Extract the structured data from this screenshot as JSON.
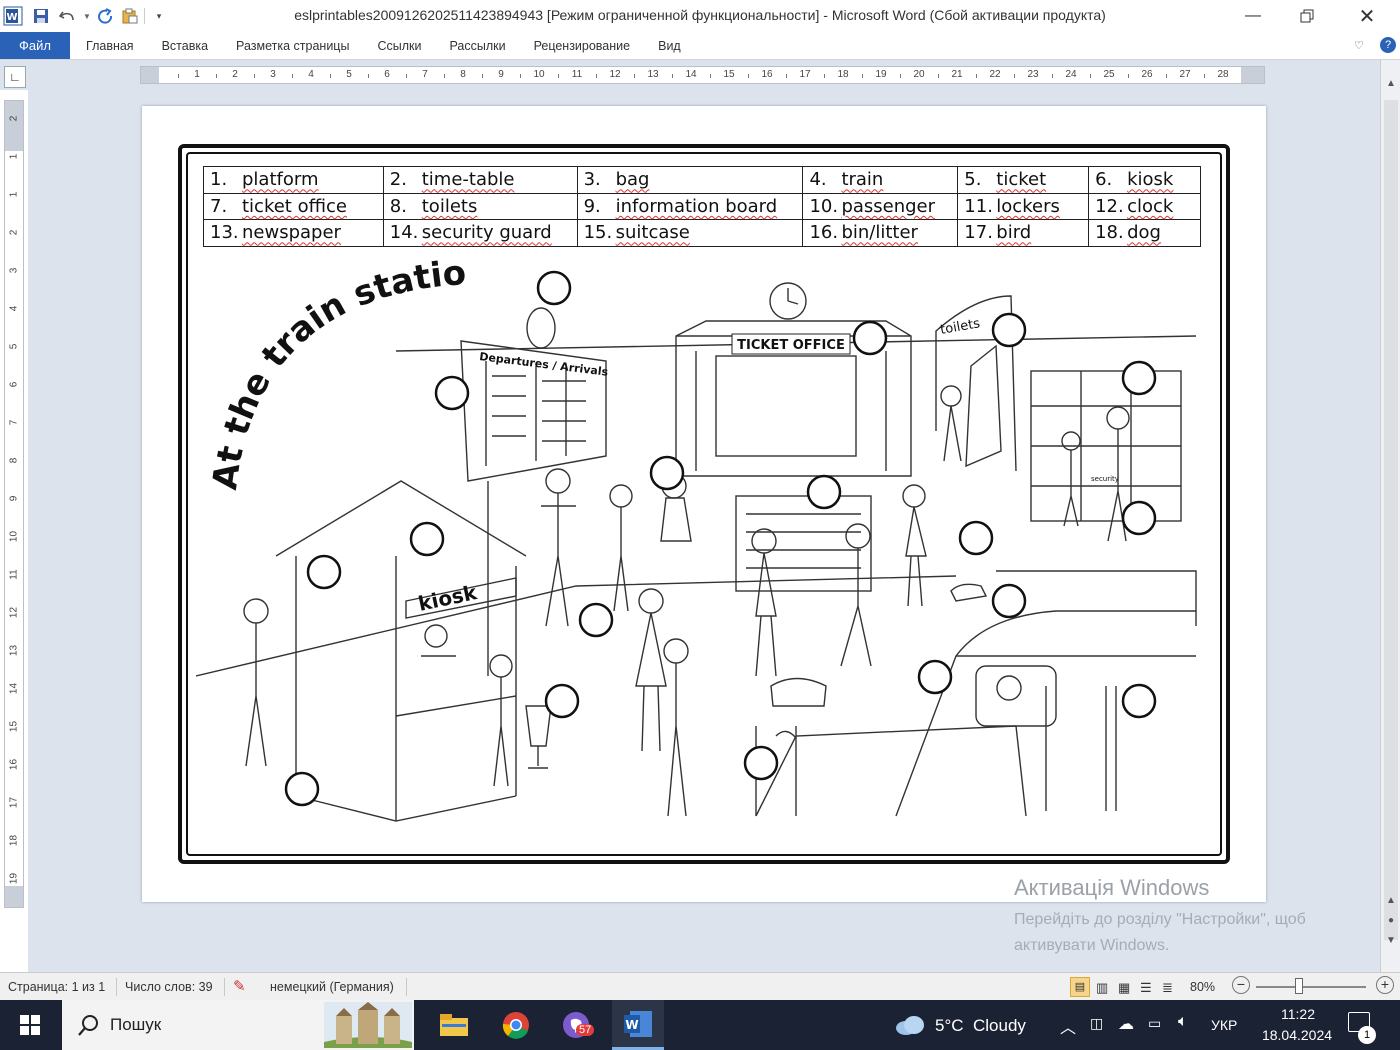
{
  "window": {
    "title": "eslprintables2009126202511423894943 [Режим ограниченной функциональности]  -  Microsoft Word (Сбой активации продукта)"
  },
  "ribbon": {
    "file_tab": "Файл",
    "tabs": [
      "Главная",
      "Вставка",
      "Разметка страницы",
      "Ссылки",
      "Рассылки",
      "Рецензирование",
      "Вид"
    ]
  },
  "ruler": {
    "h_numbers": [
      "1",
      "2",
      "3",
      "4",
      "5",
      "6",
      "7",
      "8",
      "9",
      "10",
      "11",
      "12",
      "13",
      "14",
      "15",
      "16",
      "17",
      "18",
      "19",
      "20",
      "21",
      "22",
      "23",
      "24",
      "25",
      "26",
      "27",
      "28"
    ],
    "v_numbers": [
      "2",
      "1",
      "1",
      "2",
      "3",
      "4",
      "5",
      "6",
      "7",
      "8",
      "9",
      "10",
      "11",
      "12",
      "13",
      "14",
      "15",
      "16",
      "17",
      "18",
      "19"
    ]
  },
  "worksheet": {
    "vocab_rows": [
      [
        {
          "n": "1.",
          "w": "platform"
        },
        {
          "n": "2.",
          "w": "time-table"
        },
        {
          "n": "3.",
          "w": "bag"
        },
        {
          "n": "4.",
          "w": "train"
        },
        {
          "n": "5.",
          "w": "ticket"
        },
        {
          "n": "6.",
          "w": "kiosk"
        }
      ],
      [
        {
          "n": "7.",
          "w": "ticket office"
        },
        {
          "n": "8.",
          "w": "toilets"
        },
        {
          "n": "9.",
          "w": "information board"
        },
        {
          "n": "10.",
          "w": "passenger"
        },
        {
          "n": "11.",
          "w": "lockers"
        },
        {
          "n": "12.",
          "w": "clock"
        }
      ],
      [
        {
          "n": "13.",
          "w": "newspaper"
        },
        {
          "n": "14.",
          "w": "security guard"
        },
        {
          "n": "15.",
          "w": "suitcase"
        },
        {
          "n": "16.",
          "w": "bin/litter"
        },
        {
          "n": "17.",
          "w": "bird"
        },
        {
          "n": "18.",
          "w": "dog"
        }
      ]
    ],
    "heading": "At the train station",
    "sign_departures": "Departures / Arrivals",
    "sign_ticket_office": "TICKET OFFICE",
    "sign_toilets": "toilets",
    "sign_kiosk": "kiosk",
    "sign_security": "security"
  },
  "watermark": {
    "title": "Активація Windows",
    "line1": "Перейдіть до розділу \"Настройки\", щоб",
    "line2": "активувати Windows."
  },
  "statusbar": {
    "page": "Страница: 1 из 1",
    "words": "Число слов: 39",
    "language": "немецкий (Германия)",
    "zoom": "80%",
    "zoom_level": 0.8
  },
  "taskbar": {
    "search": "Пошук",
    "weather_temp": "5°C",
    "weather_text": "Cloudy",
    "lang": "УКР",
    "time": "11:22",
    "date": "18.04.2024",
    "viber_badge": "57",
    "notif_badge": "1"
  },
  "colors": {
    "file_tab": "#2a62b8",
    "taskbar": "#1b2233",
    "workspace": "#dde3ec"
  }
}
